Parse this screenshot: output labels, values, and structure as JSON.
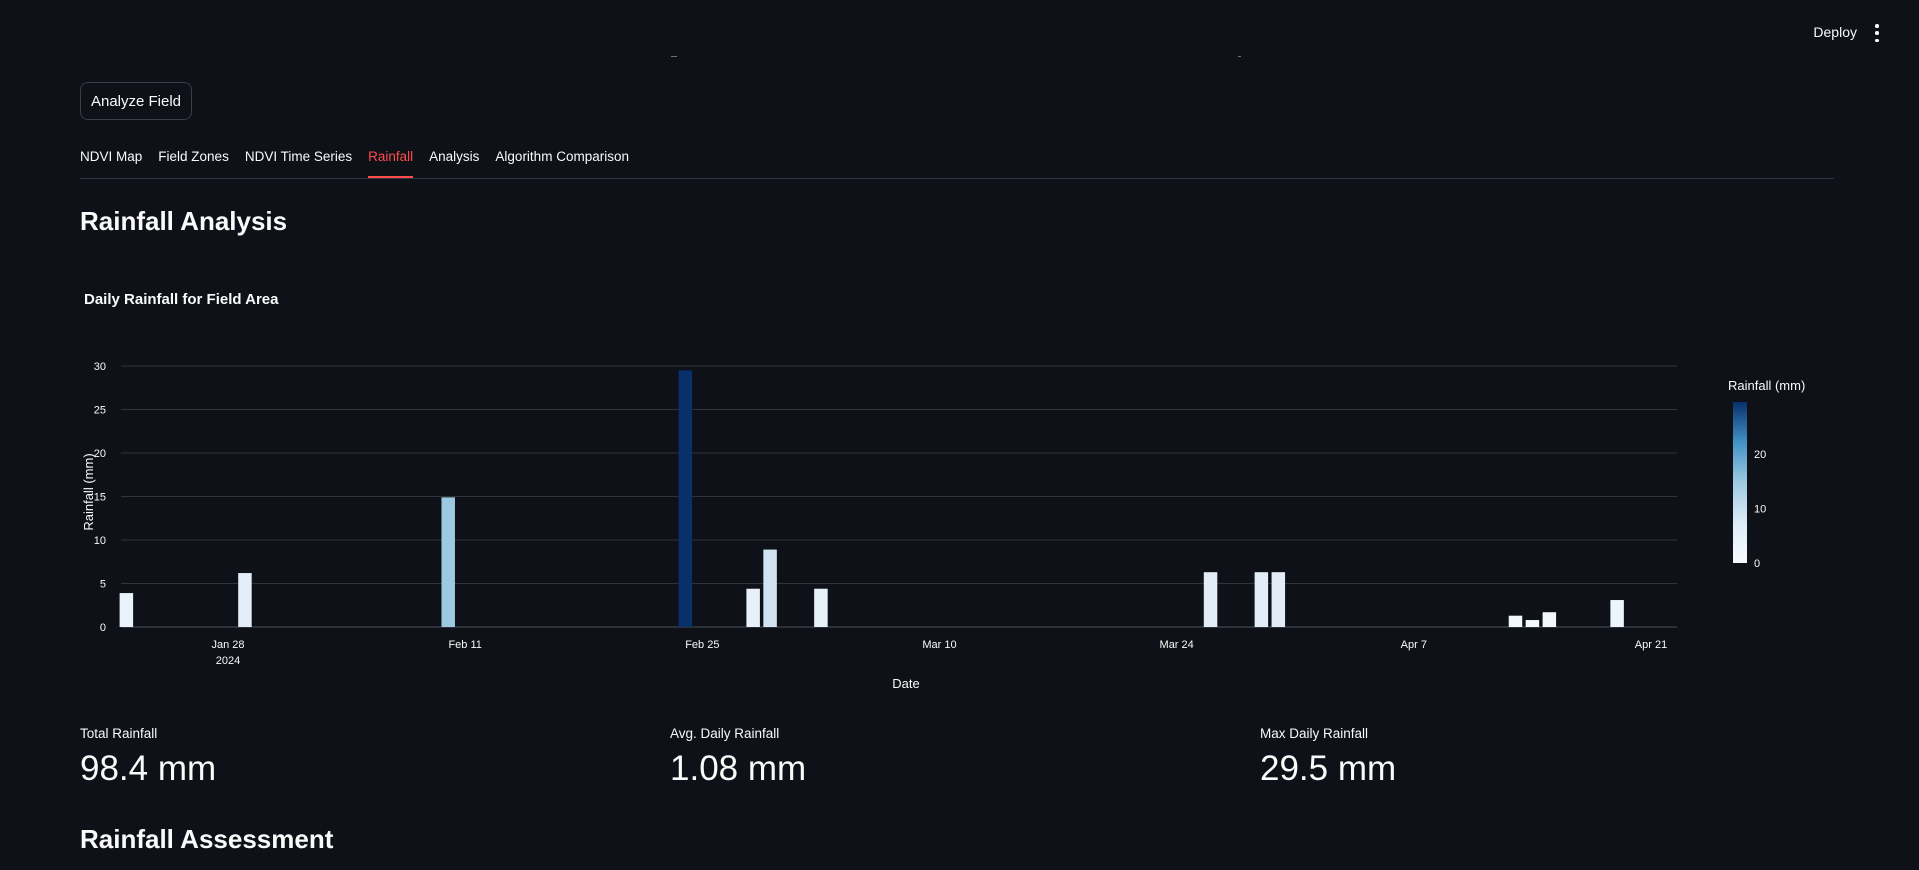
{
  "header": {
    "deploy_label": "Deploy",
    "menu_icon": "kebab-menu-icon"
  },
  "controls": {
    "analyze_button": "Analyze Field"
  },
  "tabs": [
    {
      "label": "NDVI Map",
      "active": false
    },
    {
      "label": "Field Zones",
      "active": false
    },
    {
      "label": "NDVI Time Series",
      "active": false
    },
    {
      "label": "Rainfall",
      "active": true
    },
    {
      "label": "Analysis",
      "active": false
    },
    {
      "label": "Algorithm Comparison",
      "active": false
    }
  ],
  "section_title": "Rainfall Analysis",
  "chart_data": {
    "type": "bar",
    "title": "Daily Rainfall for Field Area",
    "xlabel": "Date",
    "ylabel": "Rainfall (mm)",
    "ylim": [
      0,
      30
    ],
    "yticks": [
      0,
      5,
      10,
      15,
      20,
      25,
      30
    ],
    "xticks": [
      {
        "date": "2024-01-28",
        "label": "Jan 28",
        "sublabel": "2024"
      },
      {
        "date": "2024-02-11",
        "label": "Feb 11"
      },
      {
        "date": "2024-02-25",
        "label": "Feb 25"
      },
      {
        "date": "2024-03-10",
        "label": "Mar 10"
      },
      {
        "date": "2024-03-24",
        "label": "Mar 24"
      },
      {
        "date": "2024-04-07",
        "label": "Apr 7"
      },
      {
        "date": "2024-04-21",
        "label": "Apr 21"
      }
    ],
    "x": [
      "2024-01-22",
      "2024-01-29",
      "2024-02-10",
      "2024-02-24",
      "2024-02-28",
      "2024-02-29",
      "2024-03-03",
      "2024-03-26",
      "2024-03-29",
      "2024-03-30",
      "2024-04-13",
      "2024-04-14",
      "2024-04-15",
      "2024-04-19"
    ],
    "values": [
      3.9,
      6.2,
      14.9,
      29.5,
      4.4,
      8.9,
      4.4,
      6.3,
      6.3,
      6.3,
      1.3,
      0.8,
      1.7,
      3.1
    ],
    "grid": true,
    "colorbar": {
      "title": "Rainfall (mm)",
      "ticks": [
        0,
        10,
        20
      ],
      "range": [
        0,
        29.5
      ],
      "colors": [
        "#f7fbff",
        "#deebf7",
        "#9ecae1",
        "#4292c6",
        "#08306b"
      ]
    }
  },
  "metrics": [
    {
      "label": "Total Rainfall",
      "value": "98.4 mm"
    },
    {
      "label": "Avg. Daily Rainfall",
      "value": "1.08 mm"
    },
    {
      "label": "Max Daily Rainfall",
      "value": "29.5 mm"
    }
  ],
  "assessment_title": "Rainfall Assessment"
}
